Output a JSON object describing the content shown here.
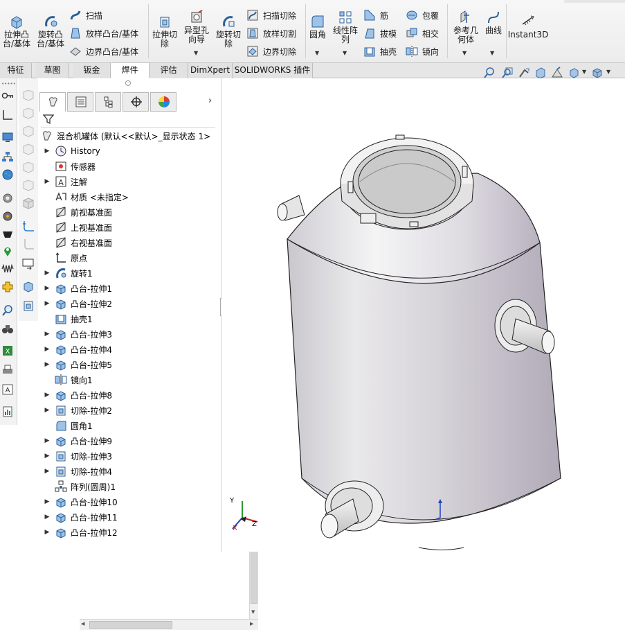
{
  "ribbon": {
    "extrude_boss": "拉伸凸\n台/基体",
    "revolve_boss": "旋转凸\n台/基体",
    "sweep": "扫描",
    "loft": "放样凸台/基体",
    "boundary": "边界凸台/基体",
    "extrude_cut": "拉伸切\n除",
    "hole_wizard": "异型孔\n向导",
    "revolve_cut": "旋转切\n除",
    "swept_cut": "扫描切除",
    "lofted_cut": "放样切割",
    "boundary_cut": "边界切除",
    "fillet": "圆角",
    "linear_pattern": "线性阵\n列",
    "rib": "筋",
    "draft": "拔模",
    "shell": "抽壳",
    "wrap": "包覆",
    "intersect": "相交",
    "mirror": "镜向",
    "ref_geometry": "参考几\n何体",
    "curves": "曲线",
    "instant3d": "Instant3D"
  },
  "tabs": [
    "特征",
    "草图",
    "钣金",
    "焊件",
    "评估",
    "DimXpert",
    "SOLIDWORKS 插件"
  ],
  "active_tab": "焊件",
  "tree": {
    "root": "混合机罐体 (默认<<默认>_显示状态 1>",
    "items": [
      {
        "label": "History",
        "expandable": true,
        "icon": "history-icon"
      },
      {
        "label": "传感器",
        "expandable": false,
        "icon": "sensor-icon"
      },
      {
        "label": "注解",
        "expandable": true,
        "icon": "annotation-icon"
      },
      {
        "label": "材质 <未指定>",
        "expandable": false,
        "icon": "material-icon"
      },
      {
        "label": "前视基准面",
        "expandable": false,
        "icon": "plane-icon"
      },
      {
        "label": "上视基准面",
        "expandable": false,
        "icon": "plane-icon"
      },
      {
        "label": "右视基准面",
        "expandable": false,
        "icon": "plane-icon"
      },
      {
        "label": "原点",
        "expandable": false,
        "icon": "origin-icon"
      },
      {
        "label": "旋转1",
        "expandable": true,
        "icon": "revolve-icon"
      },
      {
        "label": "凸台-拉伸1",
        "expandable": true,
        "icon": "extrude-icon"
      },
      {
        "label": "凸台-拉伸2",
        "expandable": true,
        "icon": "extrude-icon"
      },
      {
        "label": "抽壳1",
        "expandable": false,
        "icon": "shell-icon"
      },
      {
        "label": "凸台-拉伸3",
        "expandable": true,
        "icon": "extrude-icon"
      },
      {
        "label": "凸台-拉伸4",
        "expandable": true,
        "icon": "extrude-icon"
      },
      {
        "label": "凸台-拉伸5",
        "expandable": true,
        "icon": "extrude-icon"
      },
      {
        "label": "镜向1",
        "expandable": false,
        "icon": "mirror-icon"
      },
      {
        "label": "凸台-拉伸8",
        "expandable": true,
        "icon": "extrude-icon"
      },
      {
        "label": "切除-拉伸2",
        "expandable": true,
        "icon": "cut-icon"
      },
      {
        "label": "圆角1",
        "expandable": false,
        "icon": "fillet-icon"
      },
      {
        "label": "凸台-拉伸9",
        "expandable": true,
        "icon": "extrude-icon"
      },
      {
        "label": "切除-拉伸3",
        "expandable": true,
        "icon": "cut-icon"
      },
      {
        "label": "切除-拉伸4",
        "expandable": true,
        "icon": "cut-icon"
      },
      {
        "label": "阵列(圆周)1",
        "expandable": false,
        "icon": "circular-pattern-icon"
      },
      {
        "label": "凸台-拉伸10",
        "expandable": true,
        "icon": "extrude-icon"
      },
      {
        "label": "凸台-拉伸11",
        "expandable": true,
        "icon": "extrude-icon"
      },
      {
        "label": "凸台-拉伸12",
        "expandable": true,
        "icon": "extrude-icon"
      }
    ]
  },
  "triad": {
    "x": "X",
    "y": "Y",
    "z": "Z"
  }
}
